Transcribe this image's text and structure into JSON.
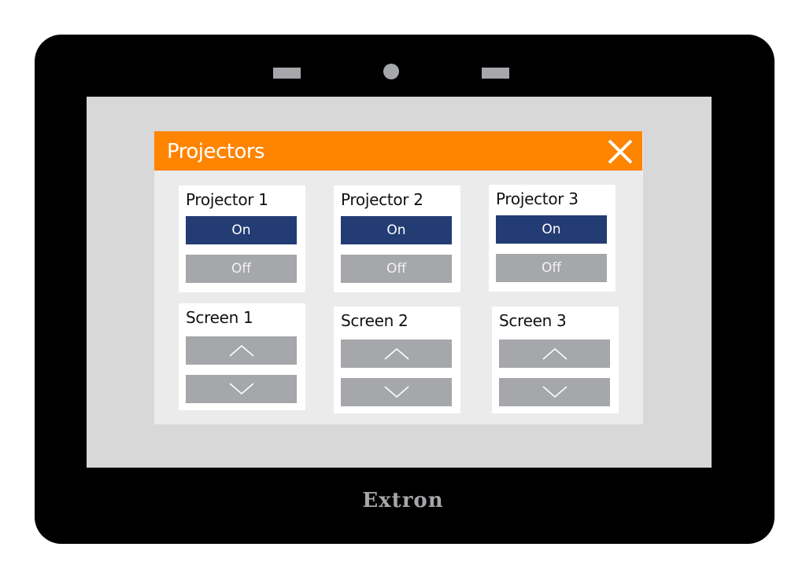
{
  "device": {
    "brand": "Extron",
    "colors": {
      "bezel": "#000000",
      "screen": "#d8d8d8",
      "sensor": "#a6a7aa"
    }
  },
  "panel": {
    "title": "Projectors",
    "close_icon": "close-x-icon",
    "colors": {
      "header": "#ff8400",
      "background": "#ebebeb",
      "on_button": "#233c73",
      "off_button": "#a6a7aa"
    }
  },
  "projectors": [
    {
      "label": "Projector 1",
      "on_label": "On",
      "off_label": "Off"
    },
    {
      "label": "Projector 2",
      "on_label": "On",
      "off_label": "Off"
    },
    {
      "label": "Projector 3",
      "on_label": "On",
      "off_label": "Off"
    }
  ],
  "screens": [
    {
      "label": "Screen 1",
      "up_icon": "chevron-up-icon",
      "down_icon": "chevron-down-icon"
    },
    {
      "label": "Screen 2",
      "up_icon": "chevron-up-icon",
      "down_icon": "chevron-down-icon"
    },
    {
      "label": "Screen 3",
      "up_icon": "chevron-up-icon",
      "down_icon": "chevron-down-icon"
    }
  ]
}
